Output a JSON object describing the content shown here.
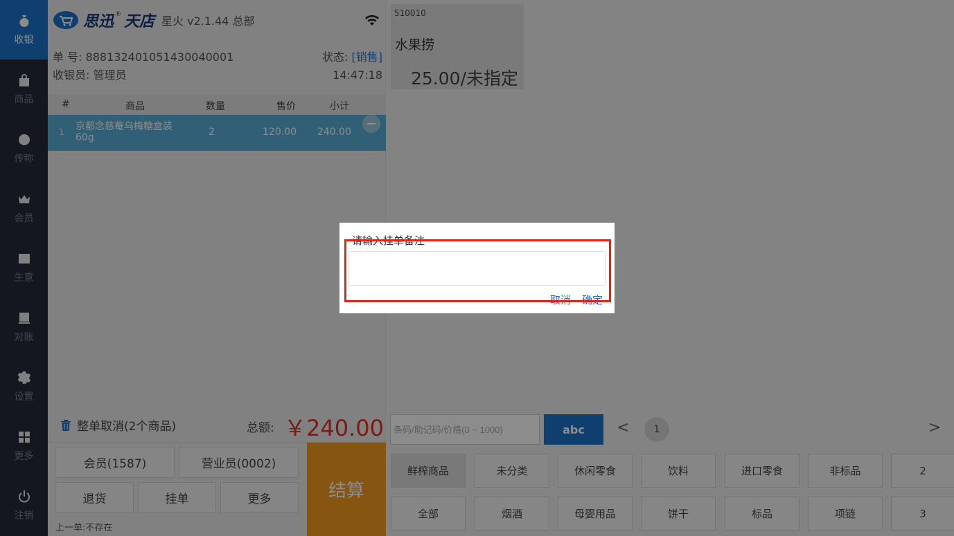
{
  "sidebar": {
    "items": [
      {
        "label": "收银",
        "icon": "money-bag-icon",
        "active": true
      },
      {
        "label": "商品",
        "icon": "bag-icon"
      },
      {
        "label": "传称",
        "icon": "scale-icon"
      },
      {
        "label": "会员",
        "icon": "crown-icon"
      },
      {
        "label": "生意",
        "icon": "store-icon"
      },
      {
        "label": "对账",
        "icon": "ledger-icon"
      },
      {
        "label": "设置",
        "icon": "gear-icon"
      },
      {
        "label": "更多",
        "icon": "grid-icon"
      },
      {
        "label": "注销",
        "icon": "power-icon"
      }
    ]
  },
  "header": {
    "brand_part1": "思迅",
    "brand_reg": "®",
    "brand_part2": "天店",
    "version": "星火 v2.1.44  总部"
  },
  "order": {
    "number_label": "单    号: 888132401051430040001",
    "status_label": "状态: ",
    "status_value": "[销售]",
    "cashier_label": "收银员: 管理员",
    "time": "14:47:18"
  },
  "table": {
    "headers": [
      "#",
      "商品",
      "数量",
      "售价",
      "小计"
    ],
    "rows": [
      {
        "index": "1",
        "name": "京都念慈菴乌梅糖盒装60g",
        "qty": "2",
        "price": "120.00",
        "subtotal": "240.00"
      }
    ]
  },
  "totals": {
    "cancel_label": "整单取消(2个商品)",
    "total_label": "总额:",
    "total_value": "￥240.00"
  },
  "actions": {
    "member": "会员(1587)",
    "salesperson": "营业员(0002)",
    "return": "退货",
    "hold": "挂单",
    "more": "更多",
    "checkout": "结算",
    "last_order": "上一单:不存在"
  },
  "product": {
    "code": "510010",
    "name": "水果捞",
    "price": "25.00/未指定"
  },
  "search": {
    "placeholder": "条码/助记码/价格(0 ~ 1000)",
    "keyboard_label": "abc",
    "page": "1",
    "prev": "<",
    "next": ">"
  },
  "categories": {
    "row1": [
      "鲜榨商品",
      "未分类",
      "休闲零食",
      "饮料",
      "进口零食",
      "非标品",
      "2"
    ],
    "row2": [
      "全部",
      "烟酒",
      "母婴用品",
      "饼干",
      "标品",
      "项链",
      "3"
    ]
  },
  "dialog": {
    "title": "请输入挂单备注",
    "input_value": "",
    "cancel": "取消",
    "confirm": "确定"
  },
  "colors": {
    "accent": "#1a73c9",
    "sidebar": "#252a3a",
    "checkout": "#f29c1f",
    "total": "#e0302a",
    "selected_row": "#5aaed6",
    "highlight": "#e2231a"
  }
}
